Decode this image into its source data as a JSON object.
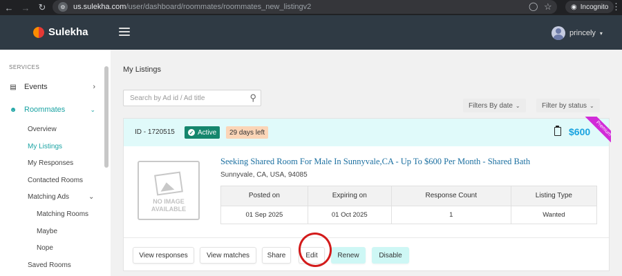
{
  "browser": {
    "url_host": "us.sulekha.com",
    "url_path": "/user/dashboard/roommates/roommates_new_listingv2",
    "mode_label": "Incognito"
  },
  "header": {
    "logo_text": "Sulekha",
    "user_name": "princely"
  },
  "sidebar": {
    "section_label": "SERVICES",
    "events_label": "Events",
    "roommates_label": "Roommates",
    "overview_label": "Overview",
    "my_listings_label": "My Listings",
    "my_responses_label": "My Responses",
    "contacted_rooms_label": "Contacted Rooms",
    "matching_ads_label": "Matching Ads",
    "matching_rooms_label": "Matching Rooms",
    "maybe_label": "Maybe",
    "nope_label": "Nope",
    "saved_rooms_label": "Saved Rooms"
  },
  "main": {
    "title": "My Listings",
    "search_placeholder": "Search by Ad id / Ad title",
    "filter_date_label": "Filters By date",
    "filter_status_label": "Filter by status"
  },
  "listing": {
    "id_text": "ID - 1720515",
    "status_label": "Active",
    "days_left": "29 days left",
    "price": "$600",
    "ribbon_label": "Premium",
    "noimage_line1": "NO IMAGE",
    "noimage_line2": "AVAILABLE",
    "title": "Seeking Shared Room For Male In Sunnyvale,CA - Up To $600 Per Month - Shared Bath",
    "location": "Sunnyvale, CA, USA, 94085",
    "table_headers": [
      "Posted on",
      "Expiring on",
      "Response Count",
      "Listing Type"
    ],
    "table_values": [
      "01 Sep 2025",
      "01 Oct 2025",
      "1",
      "Wanted"
    ]
  },
  "actions": {
    "view_responses": "View responses",
    "view_matches": "View matches",
    "share": "Share",
    "edit": "Edit",
    "renew": "Renew",
    "disable": "Disable"
  },
  "colors": {
    "header_bg": "#2f3a44",
    "accent_teal": "#1aa3a3",
    "active_badge": "#14866d",
    "price_blue": "#19a3e0",
    "premium_magenta": "#d12bd8",
    "annotation_red": "#d31b1b"
  }
}
